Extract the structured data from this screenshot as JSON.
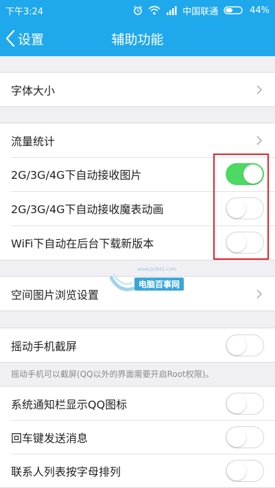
{
  "status": {
    "time": "下午3:24",
    "carrier": "中国联通",
    "battery": "44%"
  },
  "nav": {
    "back_label": "设置",
    "title": "辅助功能"
  },
  "groups": {
    "g1": [
      {
        "label": "字体大小",
        "type": "chevron"
      }
    ],
    "g2": [
      {
        "label": "流量统计",
        "type": "chevron"
      },
      {
        "label": "2G/3G/4G下自动接收图片",
        "type": "toggle",
        "on": true
      },
      {
        "label": "2G/3G/4G下自动接收魔表动画",
        "type": "toggle",
        "on": false
      },
      {
        "label": "WiFi下自动在后台下载新版本",
        "type": "toggle",
        "on": false
      }
    ],
    "g3": [
      {
        "label": "空间图片浏览设置",
        "type": "chevron"
      }
    ],
    "g4": [
      {
        "label": "摇动手机截屏",
        "type": "toggle",
        "on": false
      }
    ],
    "g4_hint": "摇动手机可以截屏(QQ以外的界面需要开启Root权限)。",
    "g5": [
      {
        "label": "系统通知栏显示QQ图标",
        "type": "toggle",
        "on": false
      },
      {
        "label": "回车键发送消息",
        "type": "toggle",
        "on": false
      },
      {
        "label": "联系人列表按字母排列",
        "type": "toggle",
        "on": false
      }
    ]
  },
  "watermark": {
    "text": "电脑百事网",
    "url": "www.pc841.com"
  },
  "colors": {
    "accent": "#1fa8ec",
    "toggle_on": "#4cd964",
    "highlight_box": "#e4202a"
  }
}
